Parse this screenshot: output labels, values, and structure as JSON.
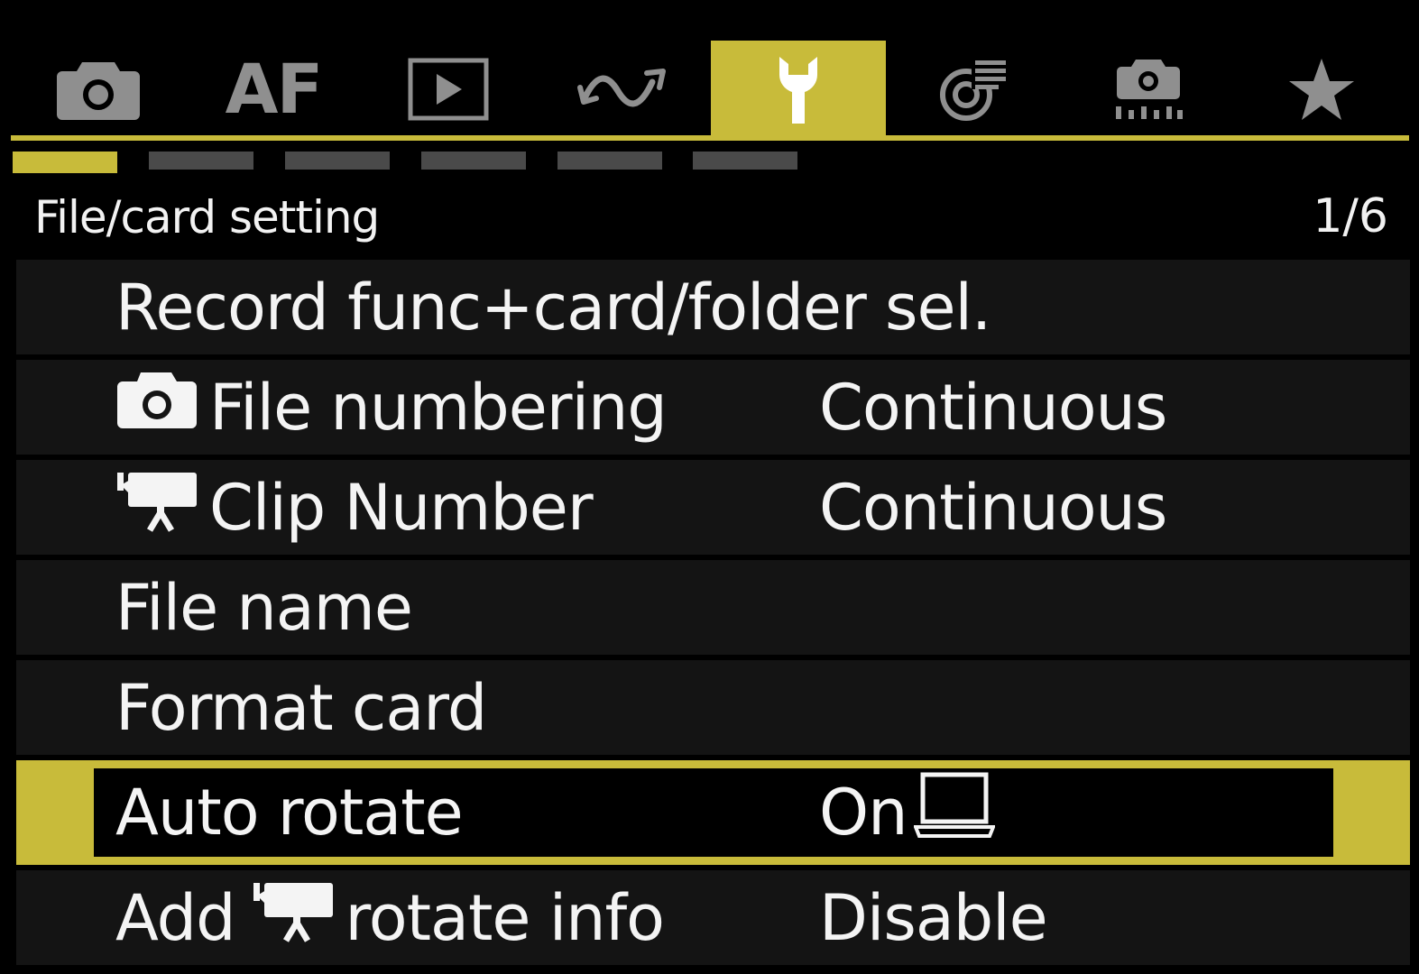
{
  "tabs": [
    {
      "id": "shooting",
      "icon": "camera-icon",
      "active": false
    },
    {
      "id": "af",
      "label": "AF",
      "active": false
    },
    {
      "id": "playback",
      "icon": "playback-icon",
      "active": false
    },
    {
      "id": "wireless",
      "icon": "wireless-icon",
      "active": false
    },
    {
      "id": "setup",
      "icon": "wrench-icon",
      "active": true
    },
    {
      "id": "custom-functions",
      "icon": "custom-functions-icon",
      "active": false
    },
    {
      "id": "custom-shooting",
      "icon": "custom-shooting-icon",
      "active": false
    },
    {
      "id": "my-menu",
      "icon": "star-icon",
      "active": false
    }
  ],
  "page_indicator": {
    "count": 6,
    "active_index": 0
  },
  "header": {
    "title": "File/card setting",
    "page": "1/6"
  },
  "menu": [
    {
      "label": "Record func+card/folder sel.",
      "value": ""
    },
    {
      "label_icon": "camera-icon",
      "label": "File numbering",
      "value": "Continuous"
    },
    {
      "label_icon": "movie-camera-icon",
      "label": "Clip Number",
      "value": "Continuous"
    },
    {
      "label": "File name",
      "value": ""
    },
    {
      "label": "Format card",
      "value": ""
    },
    {
      "label": "Auto rotate",
      "value": "On",
      "value_icon": "computer-icon",
      "selected": true
    },
    {
      "label_prefix": "Add",
      "label_icon": "movie-camera-icon",
      "label": "rotate info",
      "value": "Disable"
    }
  ],
  "colors": {
    "accent": "#c8bb3a",
    "background": "#000000",
    "row_background": "#141414",
    "inactive_icon": "#8f8f8f",
    "text": "#f4f4f4"
  }
}
